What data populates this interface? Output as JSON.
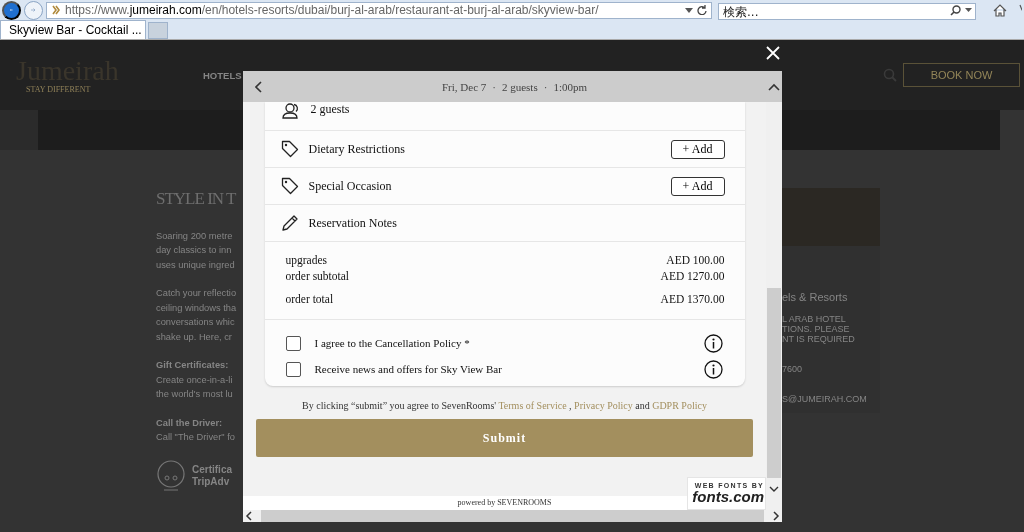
{
  "browser": {
    "url": "https://www.**jumeirah.com**/en/hotels-resorts/dubai/burj-al-arab/restaurant-at-burj-al-arab/skyview-bar/",
    "search_placeholder": "検索...",
    "tab_title": "Skyview Bar - Cocktail ..."
  },
  "site": {
    "logo": "Jumeirah",
    "tagline": "STAY DIFFERENT",
    "nav": [
      "HOTELS"
    ],
    "book_button": "BOOK NOW",
    "heading": "STYLE IN T",
    "sections": [
      {
        "lines": [
          "Soaring 200 metre",
          "day classics to inn",
          "uses unique ingred"
        ]
      },
      {
        "lines": [
          "Catch your reflectio",
          "ceiling windows tha",
          "conversations whic",
          "shake up. Here, cr"
        ]
      },
      {
        "title": "Gift Certificates:",
        "lines": [
          "Create once-in-a-li",
          "the world's most lu"
        ]
      },
      {
        "title": "Call the Driver:",
        "lines": [
          "Call \"The Driver\" fo"
        ]
      }
    ],
    "certificate": [
      "Certifica",
      "TripAdv"
    ],
    "contact": [
      {
        "kind": "title",
        "text": "els & Resorts"
      },
      {
        "kind": "small",
        "text": "L ARAB HOTEL"
      },
      {
        "kind": "small",
        "text": "TIONS. PLEASE"
      },
      {
        "kind": "small",
        "text": "NT IS REQUIRED"
      },
      {
        "kind": "gap",
        "text": "7600"
      },
      {
        "kind": "gap",
        "text": "S@JUMEIRAH.COM"
      }
    ]
  },
  "modal": {
    "header": [
      "Fri, Dec 7",
      "2 guests",
      "1:00pm"
    ],
    "header_separator": "·",
    "rows": [
      {
        "kind": "guests",
        "label": "2 guests"
      },
      {
        "kind": "tag",
        "label": "Dietary Restrictions",
        "button": "+ Add"
      },
      {
        "kind": "tag",
        "label": "Special Occasion",
        "button": "+ Add"
      },
      {
        "kind": "notes",
        "label": "Reservation Notes"
      }
    ],
    "totals": [
      {
        "kind": "line",
        "label": "upgrades",
        "amount": "AED 100.00"
      },
      {
        "kind": "line",
        "label": "order subtotal",
        "amount": "AED 1270.00"
      },
      {
        "kind": "grand",
        "label": "order total",
        "amount": "AED 1370.00"
      }
    ],
    "options": [
      {
        "label": "I agree to the Cancellation Policy *",
        "checked": false
      },
      {
        "label": "Receive news and offers for Sky View Bar",
        "checked": false
      }
    ],
    "terms": [
      {
        "kind": "text",
        "text": "By clicking “submit” you agree to SevenRooms'"
      },
      {
        "kind": "link",
        "text": "Terms of Service"
      },
      {
        "kind": "text",
        "text": ","
      },
      {
        "kind": "link",
        "text": "Privacy Policy"
      },
      {
        "kind": "text",
        "text": "and"
      },
      {
        "kind": "link",
        "text": "GDPR Policy"
      }
    ],
    "submit": "Submit",
    "powered_by": "powered by SEVENROOMS",
    "fonts_badge": {
      "top": "WEB FONTS BY",
      "brand": "fonts.com"
    }
  }
}
